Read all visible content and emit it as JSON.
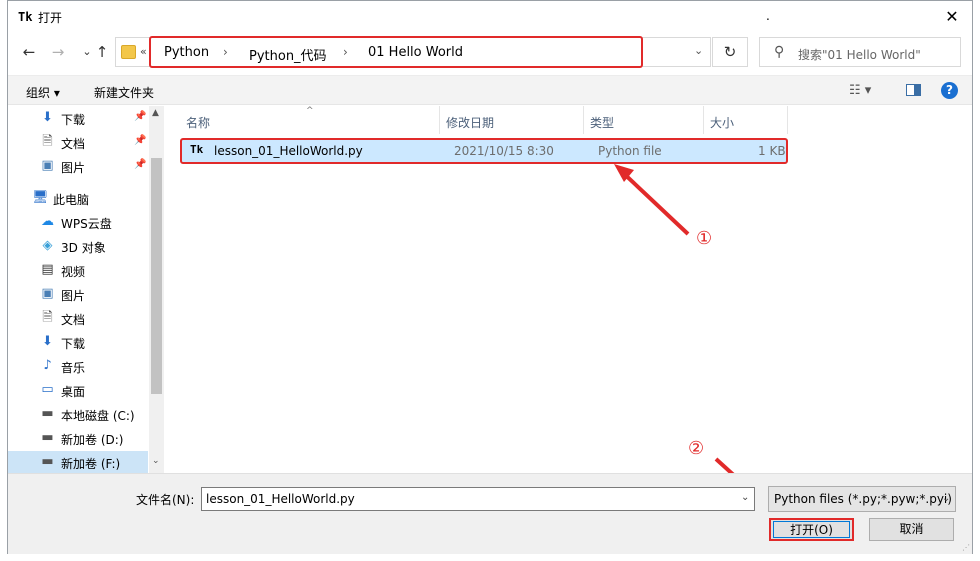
{
  "window": {
    "title": "打开",
    "title_extra": ".",
    "close_label": "✕",
    "app_icon": "Tk"
  },
  "nav": {
    "back": "←",
    "forward": "→",
    "up": "↑",
    "refresh": "↻"
  },
  "address": {
    "more": "«",
    "crumbs": [
      "Python",
      "Python_代码",
      "01 Hello World"
    ],
    "separator": "›",
    "dropdown": "⌄"
  },
  "search": {
    "placeholder": "搜索\"01 Hello World\"",
    "icon": "⚲"
  },
  "toolbar": {
    "organize": "组织 ▾",
    "new_folder": "新建文件夹",
    "view_icon": "☷ ▾",
    "help": "?"
  },
  "sidebar": {
    "pinned": [
      {
        "label": "下载",
        "icon": "download-icon",
        "glyph": "⬇",
        "pin": "📌"
      },
      {
        "label": "文档",
        "icon": "document-icon",
        "glyph": "🗎",
        "pin": "📌"
      },
      {
        "label": "图片",
        "icon": "picture-icon",
        "glyph": "▣",
        "pin": "📌"
      }
    ],
    "this_pc": {
      "label": "此电脑",
      "glyph": "🖥"
    },
    "items": [
      {
        "label": "WPS云盘",
        "glyph": "☁"
      },
      {
        "label": "3D 对象",
        "glyph": "◈"
      },
      {
        "label": "视频",
        "glyph": "▤"
      },
      {
        "label": "图片",
        "glyph": "▣"
      },
      {
        "label": "文档",
        "glyph": "🗎"
      },
      {
        "label": "下载",
        "glyph": "⬇"
      },
      {
        "label": "音乐",
        "glyph": "♪"
      },
      {
        "label": "桌面",
        "glyph": "▭"
      },
      {
        "label": "本地磁盘 (C:)",
        "glyph": "▬"
      },
      {
        "label": "新加卷 (D:)",
        "glyph": "▬"
      },
      {
        "label": "新加卷 (F:)",
        "glyph": "▬"
      }
    ],
    "scroll_up": "▲",
    "scroll_down": "⌄"
  },
  "filelist": {
    "columns": [
      "名称",
      "修改日期",
      "类型",
      "大小"
    ],
    "sort_arrow": "^",
    "rows": [
      {
        "icon": "Tk",
        "name": "lesson_01_HelloWorld.py",
        "modified": "2021/10/15 8:30",
        "type": "Python file",
        "size": "1 KB"
      }
    ]
  },
  "annotations": {
    "one": "①",
    "two": "②"
  },
  "bottom": {
    "filename_label": "文件名(N):",
    "filename_value": "lesson_01_HelloWorld.py",
    "dropdown": "⌄",
    "filter": "Python files (*.py;*.pyw;*.pyi)",
    "open": "打开(O)",
    "cancel": "取消"
  },
  "colors": {
    "annotation": "#e12a2a",
    "selection": "#cce8ff",
    "accent": "#0078d7"
  }
}
